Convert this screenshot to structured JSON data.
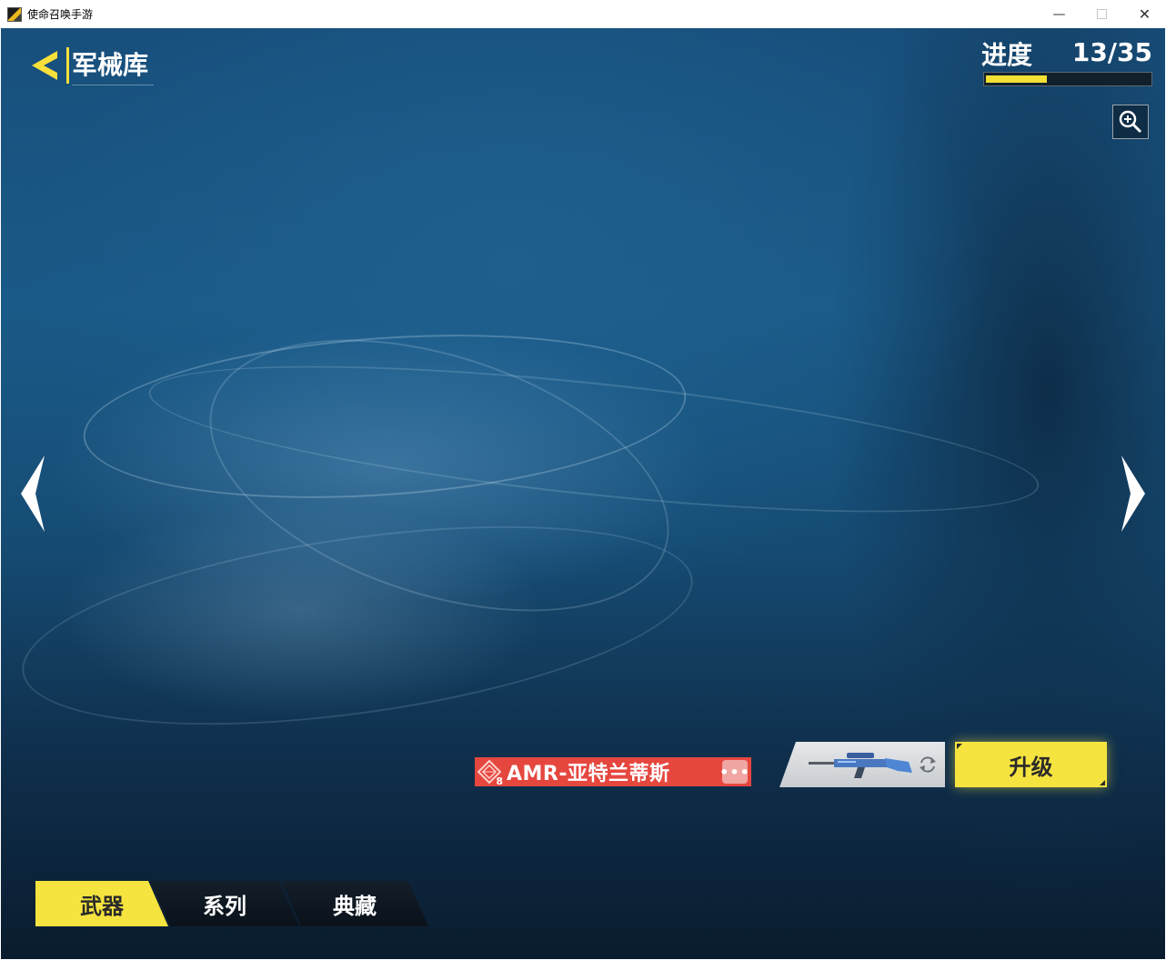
{
  "window": {
    "title": "使命召唤手游",
    "minimize_glyph": "—",
    "close_glyph": "✕"
  },
  "header": {
    "title": "军械库",
    "back_icon": "back-chevron-icon"
  },
  "progress": {
    "label": "进度",
    "count_text": "13/35",
    "current": 13,
    "total": 35
  },
  "toolbar": {
    "zoom_icon": "zoom-in-icon"
  },
  "weapon": {
    "name": "AMR-亚特兰蒂斯",
    "rarity_level": "8",
    "more_glyph": "•••",
    "tag_color": "#e5473f"
  },
  "actions": {
    "upgrade_label": "升级",
    "accent": "#f5e43f"
  },
  "tabs": [
    {
      "label": "武器",
      "active": true
    },
    {
      "label": "系列",
      "active": false
    },
    {
      "label": "典藏",
      "active": false
    }
  ]
}
